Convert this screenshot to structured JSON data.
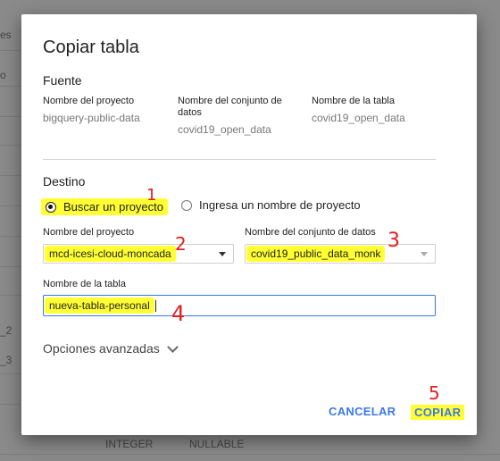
{
  "background": {
    "top_left_text": "es",
    "side_text_1": "o",
    "side_text_2": "_2",
    "side_text_3": "_3",
    "bottom_text_1": "INTEGER",
    "bottom_text_2": "NULLABLE"
  },
  "dialog": {
    "title": "Copiar tabla",
    "source": {
      "heading": "Fuente",
      "project_label": "Nombre del proyecto",
      "project_value": "bigquery-public-data",
      "dataset_label": "Nombre del conjunto de datos",
      "dataset_value": "covid19_open_data",
      "table_label": "Nombre de la tabla",
      "table_value": "covid19_open_data"
    },
    "destination": {
      "heading": "Destino",
      "radio_search": "Buscar un proyecto",
      "radio_enter": "Ingresa un nombre de proyecto",
      "project_label": "Nombre del proyecto",
      "project_value": "mcd-icesi-cloud-moncada",
      "dataset_label": "Nombre del conjunto de datos",
      "dataset_value": "covid19_public_data_monk",
      "table_label": "Nombre de la tabla",
      "table_value": "nueva-tabla-personal"
    },
    "advanced_label": "Opciones avanzadas",
    "cancel_label": "CANCELAR",
    "copy_label": "COPIAR"
  },
  "annotations": [
    "1",
    "2",
    "3",
    "4",
    "5"
  ],
  "colors": {
    "accent": "#3b78e7",
    "highlight": "#ffff33",
    "annotation": "#e02020"
  }
}
